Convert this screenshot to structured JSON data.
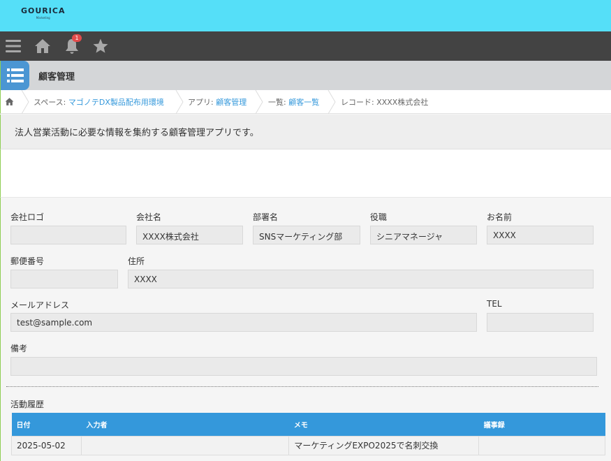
{
  "brand": {
    "logo": "GOURICA",
    "logo_sub": "Marketing"
  },
  "nav": {
    "notification_count": "1"
  },
  "app": {
    "title": "顧客管理"
  },
  "breadcrumb": {
    "space_prefix": "スペース: ",
    "space": "マゴノテDX製品配布用環境",
    "app_prefix": "アプリ: ",
    "app": "顧客管理",
    "list_prefix": "一覧: ",
    "list": "顧客一覧",
    "record": "レコード: XXXX株式会社"
  },
  "description": "法人営業活動に必要な情報を集約する顧客管理アプリです。",
  "fields": {
    "logo": {
      "label": "会社ロゴ",
      "value": ""
    },
    "company": {
      "label": "会社名",
      "value": "XXXX株式会社"
    },
    "department": {
      "label": "部署名",
      "value": "SNSマーケティング部"
    },
    "position": {
      "label": "役職",
      "value": "シニアマネージャ"
    },
    "name": {
      "label": "お名前",
      "value": "XXXX"
    },
    "postal": {
      "label": "郵便番号",
      "value": ""
    },
    "address": {
      "label": "住所",
      "value": "XXXX"
    },
    "email": {
      "label": "メールアドレス",
      "value": "test@sample.com"
    },
    "tel": {
      "label": "TEL",
      "value": ""
    },
    "notes": {
      "label": "備考",
      "value": ""
    }
  },
  "history": {
    "label": "活動履歴",
    "columns": [
      "日付",
      "入力者",
      "メモ",
      "議事録"
    ],
    "rows": [
      {
        "date": "2025-05-02",
        "author": "",
        "memo": "マーケティングEXPO2025で名刺交換",
        "minutes": ""
      }
    ]
  },
  "colors": {
    "topbar": "#55dff8",
    "navbar": "#434343",
    "accent": "#3498db",
    "badge": "#e24c4c"
  },
  "icons": [
    "menu-icon",
    "home-icon",
    "bell-icon",
    "star-icon",
    "list-icon"
  ]
}
